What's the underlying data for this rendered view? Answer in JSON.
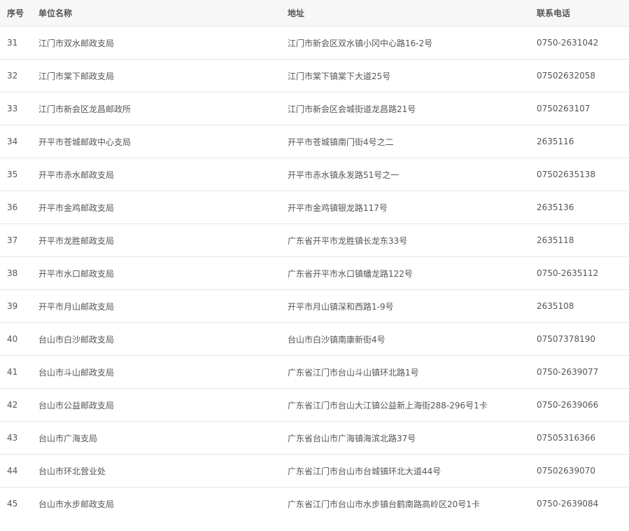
{
  "table": {
    "headers": [
      "序号",
      "单位名称",
      "地址",
      "联系电话"
    ],
    "rows": [
      {
        "seq": "31",
        "name": "江门市双水邮政支局",
        "address": "江门市新会区双水镇小冈中心路16-2号",
        "phone": "0750-2631042"
      },
      {
        "seq": "32",
        "name": "江门市棠下邮政支局",
        "address": "江门市棠下镇棠下大道25号",
        "phone": "07502632058"
      },
      {
        "seq": "33",
        "name": "江门市新会区龙昌邮政所",
        "address": "江门市新会区会城街道龙昌路21号",
        "phone": "0750263107"
      },
      {
        "seq": "34",
        "name": "开平市苍城邮政中心支局",
        "address": "开平市苍城镇南门街4号之二",
        "phone": "2635116"
      },
      {
        "seq": "35",
        "name": "开平市赤水邮政支局",
        "address": "开平市赤水镇永发路51号之一",
        "phone": "07502635138"
      },
      {
        "seq": "36",
        "name": "开平市金鸡邮政支局",
        "address": "开平市金鸡镇银龙路117号",
        "phone": "2635136"
      },
      {
        "seq": "37",
        "name": "开平市龙胜邮政支局",
        "address": "广东省开平市龙胜镇长龙东33号",
        "phone": "2635118"
      },
      {
        "seq": "38",
        "name": "开平市水口邮政支局",
        "address": "广东省开平市水口镇蟠龙路122号",
        "phone": "0750-2635112"
      },
      {
        "seq": "39",
        "name": "开平市月山邮政支局",
        "address": "开平市月山镇深和西路1-9号",
        "phone": "2635108"
      },
      {
        "seq": "40",
        "name": "台山市白沙邮政支局",
        "address": "台山市白沙镇南康新街4号",
        "phone": "07507378190"
      },
      {
        "seq": "41",
        "name": "台山市斗山邮政支局",
        "address": "广东省江门市台山斗山镇环北路1号",
        "phone": "0750-2639077"
      },
      {
        "seq": "42",
        "name": "台山市公益邮政支局",
        "address": "广东省江门市台山大江镇公益新上海街288-296号1卡",
        "phone": "0750-2639066"
      },
      {
        "seq": "43",
        "name": "台山市广海支局",
        "address": "广东省台山市广海镇海滨北路37号",
        "phone": "07505316366"
      },
      {
        "seq": "44",
        "name": "台山市环北营业处",
        "address": "广东省江门市台山市台城镇环北大道44号",
        "phone": "07502639070"
      },
      {
        "seq": "45",
        "name": "台山市水步邮政支局",
        "address": "广东省江门市台山市水步镇台鹤南路高岭区20号1卡",
        "phone": "0750-2639084"
      }
    ]
  }
}
